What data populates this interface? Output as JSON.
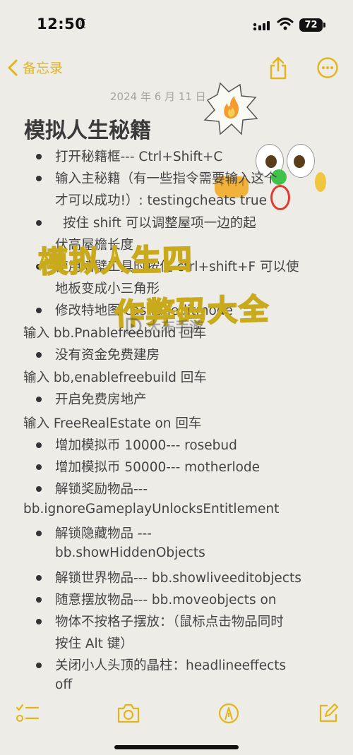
{
  "status": {
    "time": "12:50",
    "battery": "72"
  },
  "nav": {
    "back_label": "备忘录"
  },
  "note": {
    "date": "2024 年 6 月 11 日",
    "title": "模拟人生秘籍",
    "lines": [
      "打开秘籍框--- Ctrl+Shift+C",
      "输入主秘籍（有一些指令需要输入这个",
      "才可以成功!）:  testingcheats true",
      "按住 shift 可以调整屋项一边的起",
      "伏高屋檐长度",
      "使用墙壁工具时按住 ctrl+shift+F 可以使",
      "地板变成小三角形",
      "修改特地图 cas.fulleditmode",
      "输入 bb.Pnablefreebuild 回车",
      "没有资金免费建房",
      "输入 bb,enablefreebuild 回车",
      "开启免费房地产",
      "输入 FreeRealEstate on 回车",
      "增加模拟币 10000--- rosebud",
      "增加模拟币 50000--- motherlode",
      "解锁奖励物品---",
      "bb.ignoreGameplayUnlocksEntitlement",
      "解锁隐藏物品 ---",
      "bb.showHiddenObjects",
      "解锁世界物品--- bb.showliveeditobjects",
      "随意摆放物品--- bb.moveobjects on",
      "物体不按格子摆放：（鼠标点击物品同时",
      "按住 Alt 键）",
      "关闭小人头顶的晶柱：headlineeffects",
      "off"
    ]
  },
  "overlay": {
    "line1": "模拟人生四",
    "line2": "作弊码大全",
    "watermark": "大东手游"
  },
  "icons": {
    "back": "chevron-left-icon",
    "share": "share-icon",
    "more": "ellipsis-icon",
    "checklist": "checklist-icon",
    "camera": "camera-icon",
    "markup": "pen-icon",
    "compose": "compose-icon"
  },
  "colors": {
    "accent": "#e3b51b",
    "background": "#edece7"
  }
}
